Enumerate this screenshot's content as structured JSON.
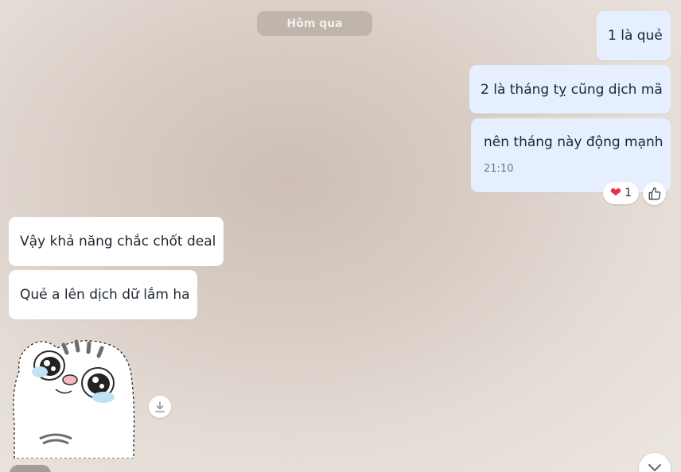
{
  "chat": {
    "date_separator": "Hôm qua",
    "messages": [
      {
        "direction": "outgoing",
        "text": "1 là quẻ"
      },
      {
        "direction": "outgoing",
        "text": "2 là tháng tỵ cũng dịch mã"
      },
      {
        "direction": "outgoing",
        "text": "nên tháng này động mạnh",
        "time": "21:10"
      },
      {
        "direction": "incoming",
        "text": "Vậy khả năng chắc chốt deal"
      },
      {
        "direction": "incoming",
        "text": "Quẻ a lên dịch dữ lắm ha"
      },
      {
        "direction": "incoming",
        "type": "sticker",
        "sticker": "crying-cat-sticker"
      }
    ],
    "reaction": {
      "emoji": "heart-icon",
      "count": "1"
    }
  },
  "colors": {
    "outgoing_bubble": "#e5efff",
    "incoming_bubble": "#ffffff",
    "heart": "#e8304a"
  }
}
